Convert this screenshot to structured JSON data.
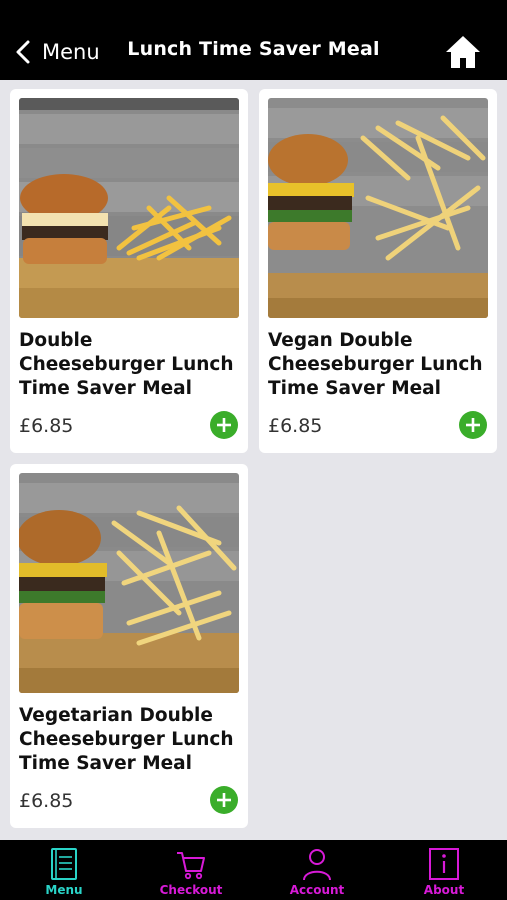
{
  "header": {
    "back_label": "Menu",
    "title": "Lunch Time Saver Meal"
  },
  "products": [
    {
      "name": "Double Cheeseburger Lunch Time Saver Meal",
      "price": "£6.85"
    },
    {
      "name": "Vegan Double Cheeseburger Lunch Time Saver Meal",
      "price": "£6.85"
    },
    {
      "name": "Vegetarian Double Cheeseburger Lunch Time Saver Meal",
      "price": "£6.85"
    }
  ],
  "tabs": [
    {
      "label": "Menu",
      "icon": "menu-book-icon",
      "color": "#2ad4c8",
      "active": true
    },
    {
      "label": "Checkout",
      "icon": "cart-icon",
      "color": "#d81ad8"
    },
    {
      "label": "Account",
      "icon": "person-icon",
      "color": "#d81ad8"
    },
    {
      "label": "About",
      "icon": "info-icon",
      "color": "#d81ad8"
    }
  ],
  "colors": {
    "header_bg": "#000000",
    "page_bg": "#e5e5ea",
    "add_button": "#3aad2a",
    "tab_active": "#2ad4c8",
    "tab_inactive": "#d81ad8"
  }
}
